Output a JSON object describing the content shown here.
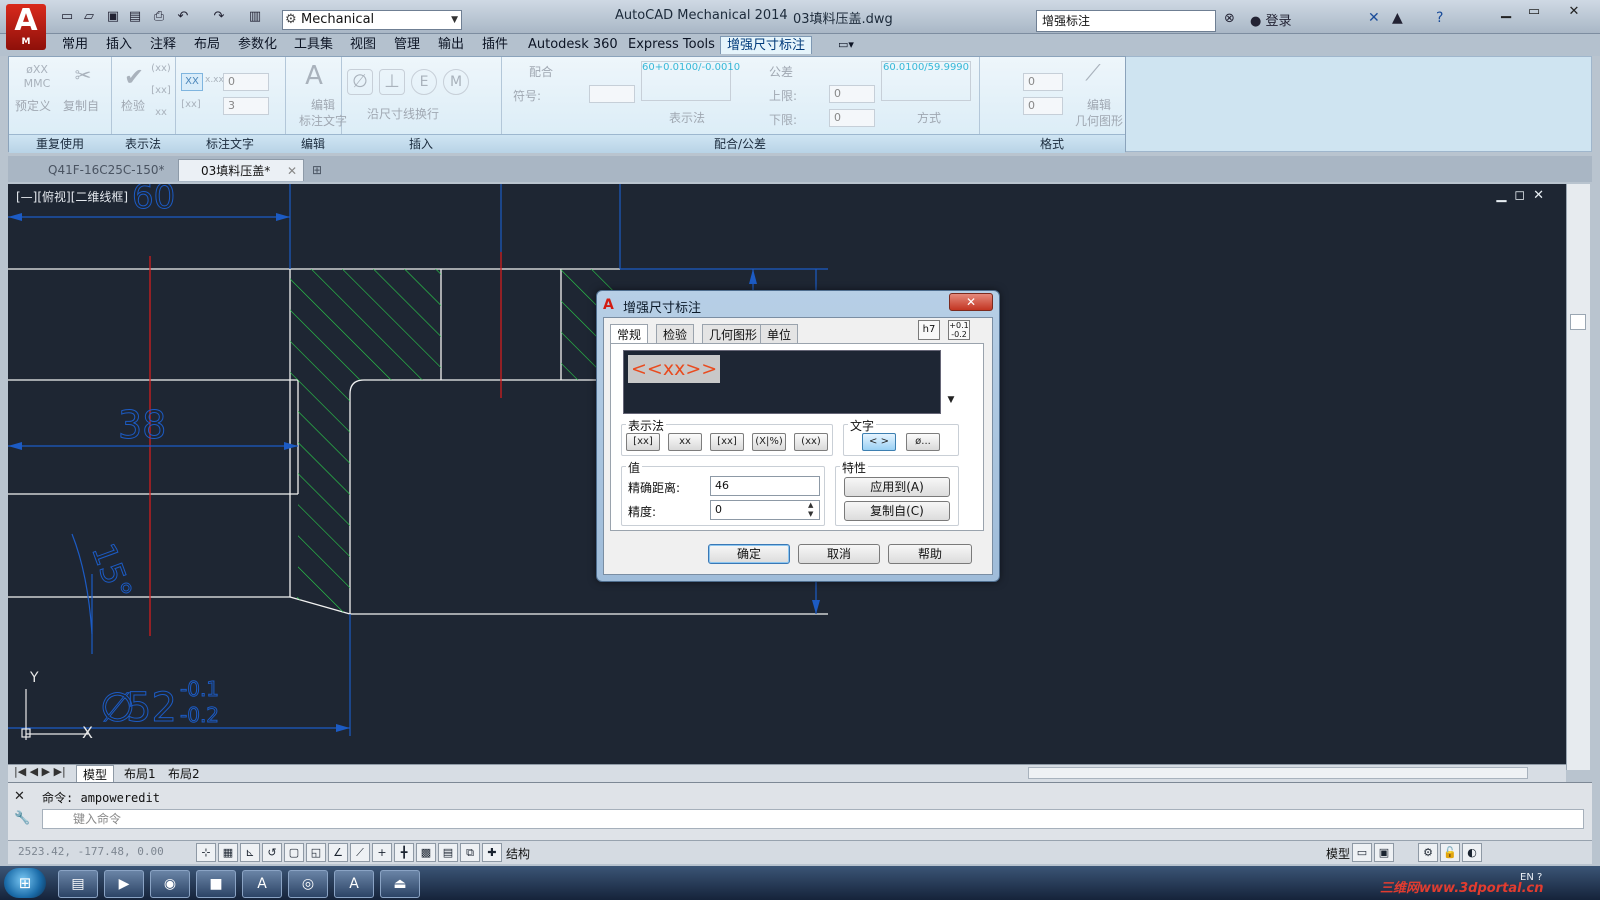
{
  "app": {
    "title": "AutoCAD Mechanical 2014",
    "file": "03填料压盖.dwg",
    "workspace": "Mechanical",
    "search_placeholder": "增强标注",
    "login": "登录"
  },
  "ribbon_tabs": [
    "常用",
    "插入",
    "注释",
    "布局",
    "参数化",
    "工具集",
    "视图",
    "管理",
    "输出",
    "插件",
    "Autodesk 360",
    "Express Tools",
    "增强尺寸标注"
  ],
  "ribbon": {
    "panels": [
      "重复使用",
      "表示法",
      "标注文字",
      "编辑",
      "插入",
      "配合/公差",
      "格式"
    ],
    "labels": {
      "predefine": "预定义",
      "copy_from": "复制自",
      "check": "检验",
      "edit_text": "编辑\n标注文字",
      "along_line": "沿尺寸线换行",
      "fit": "配合",
      "symbol": "符号:",
      "display": "表示法",
      "tolerance": "公差",
      "upper": "上限:",
      "lower": "下限:",
      "method": "方式",
      "edit_geom": "编辑\n几何图形",
      "fit_sample": "60+0.0100/-0.0010",
      "tol_sample": "60.0100/59.9990"
    },
    "inputs": {
      "precision_a": "0",
      "precision_b": "3",
      "upper": "0",
      "lower": "0",
      "fmt_a": "0",
      "fmt_b": "0"
    }
  },
  "doc_tabs": [
    "Q41F-16C25C-150*",
    "03填料压盖*"
  ],
  "viewport": {
    "tag": "[—][俯视][二维线框]",
    "dims": {
      "d38": "38",
      "d52": "52",
      "tol_up": "-0.1",
      "tol_dn": "-0.2",
      "angle": "15°",
      "top": "60"
    }
  },
  "layout_tabs": [
    "模型",
    "布局1",
    "布局2"
  ],
  "command": {
    "history_label": "命令:",
    "history_value": "ampoweredit",
    "placeholder": "键入命令"
  },
  "status": {
    "coords": "2523.42, -177.48, 0.00",
    "structure": "结构",
    "model": "模型"
  },
  "dialog": {
    "title": "增强尺寸标注",
    "tabs": [
      "常规",
      "检验",
      "几何图形",
      "单位"
    ],
    "corner_buttons": [
      "h7",
      "+0.1\n-0.2"
    ],
    "edit_text": "<<xx>>",
    "group_display": "表示法",
    "display_buttons": [
      "[xx]",
      "xx",
      "[xx]",
      "(X|%)",
      "(xx)"
    ],
    "group_text": "文字",
    "text_buttons": [
      "< >",
      "ø..."
    ],
    "group_value": "值",
    "exact_label": "精确距离:",
    "exact_value": "46",
    "precision_label": "精度:",
    "precision_value": "0",
    "group_props": "特性",
    "apply_to": "应用到(A)",
    "copy_from": "复制自(C)",
    "ok": "确定",
    "cancel": "取消",
    "help": "帮助"
  },
  "taskbar": {
    "watermark": "三维网www.3dportal.cn",
    "lang": "EN"
  },
  "colors": {
    "canvas": "#1e2633",
    "hatch": "#2ad04a",
    "dim": "#1c5bc4",
    "center": "#d21e1e",
    "outline": "#f2f2f2"
  }
}
